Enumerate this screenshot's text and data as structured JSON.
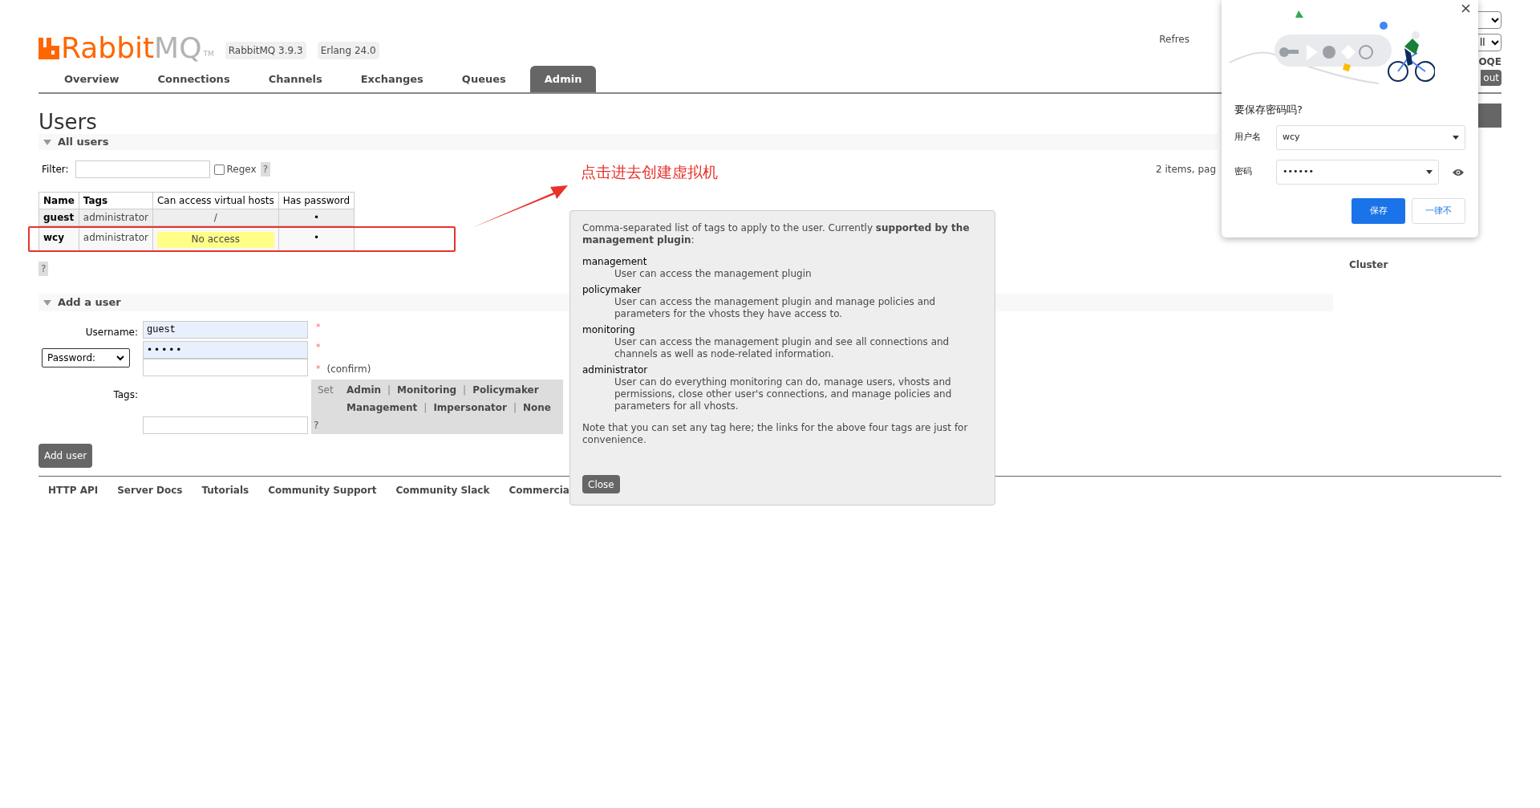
{
  "header": {
    "logo": {
      "brand": "Rabbit",
      "suffix": "MQ",
      "mark": "TM"
    },
    "badges": [
      "RabbitMQ 3.9.3",
      "Erlang 24.0"
    ],
    "refresh_label": "Refres",
    "selects": [
      {
        "value": "ll"
      }
    ],
    "user": "OQE",
    "logout_button": "out"
  },
  "tabs": [
    {
      "label": "Overview",
      "selected": false
    },
    {
      "label": "Connections",
      "selected": false
    },
    {
      "label": "Channels",
      "selected": false
    },
    {
      "label": "Exchanges",
      "selected": false
    },
    {
      "label": "Queues",
      "selected": false
    },
    {
      "label": "Admin",
      "selected": true
    }
  ],
  "page_title": "Users",
  "all_users": {
    "title": "All users",
    "expanded": true,
    "filter_label": "Filter:",
    "regex_label": "Regex",
    "regex_checked": false,
    "help": "?",
    "pagination": "2 items, pag",
    "columns": [
      "Name",
      "Tags",
      "Can access virtual hosts",
      "Has password"
    ],
    "rows": [
      {
        "name": "guest",
        "tags": "administrator",
        "vhosts": "/",
        "no_access": false,
        "has_password": "•"
      },
      {
        "name": "wcy",
        "tags": "administrator",
        "vhosts": "No access",
        "no_access": true,
        "has_password": "•"
      }
    ],
    "help_below": "?"
  },
  "add_user": {
    "title": "Add a user",
    "expanded": true,
    "username_label": "Username:",
    "username_value": "guest",
    "password_mode": "Password:",
    "password_value": "•••••",
    "required_mark": "*",
    "confirm_label": "(confirm)",
    "tags_label": "Tags:",
    "set_label": "Set",
    "tag_separator": "|",
    "tag_links": [
      "Admin",
      "Monitoring",
      "Policymaker",
      "Management",
      "Impersonator",
      "None"
    ],
    "tags_help": "?",
    "submit": "Add user"
  },
  "sidebar": {
    "items": [
      "Cluster"
    ]
  },
  "footer": [
    "HTTP API",
    "Server Docs",
    "Tutorials",
    "Community Support",
    "Community Slack",
    "Commercia"
  ],
  "annotation": {
    "text": "点击进去创建虚拟机"
  },
  "help_dialog": {
    "intro": "Comma-separated list of tags to apply to the user. Currently **supported by the management plugin**:",
    "definitions": [
      {
        "term": "management",
        "description": "User can access the management plugin"
      },
      {
        "term": "policymaker",
        "description": "User can access the management plugin and manage policies and parameters for the vhosts they have access to."
      },
      {
        "term": "monitoring",
        "description": "User can access the management plugin and see all connections and channels as well as node-related information."
      },
      {
        "term": "administrator",
        "description": "User can do everything monitoring can do, manage users, vhosts and permissions, close other user's connections, and manage policies and parameters for all vhosts."
      }
    ],
    "note": "Note that you can set any tag here; the links for the above four tags are just for convenience.",
    "close_button": "Close"
  },
  "password_prompt": {
    "title": "要保存密码吗?",
    "username_label": "用户名",
    "username_value": "wcy",
    "password_label": "密码",
    "password_value": "••••••",
    "save_button": "保存",
    "never_button": "一律不"
  }
}
